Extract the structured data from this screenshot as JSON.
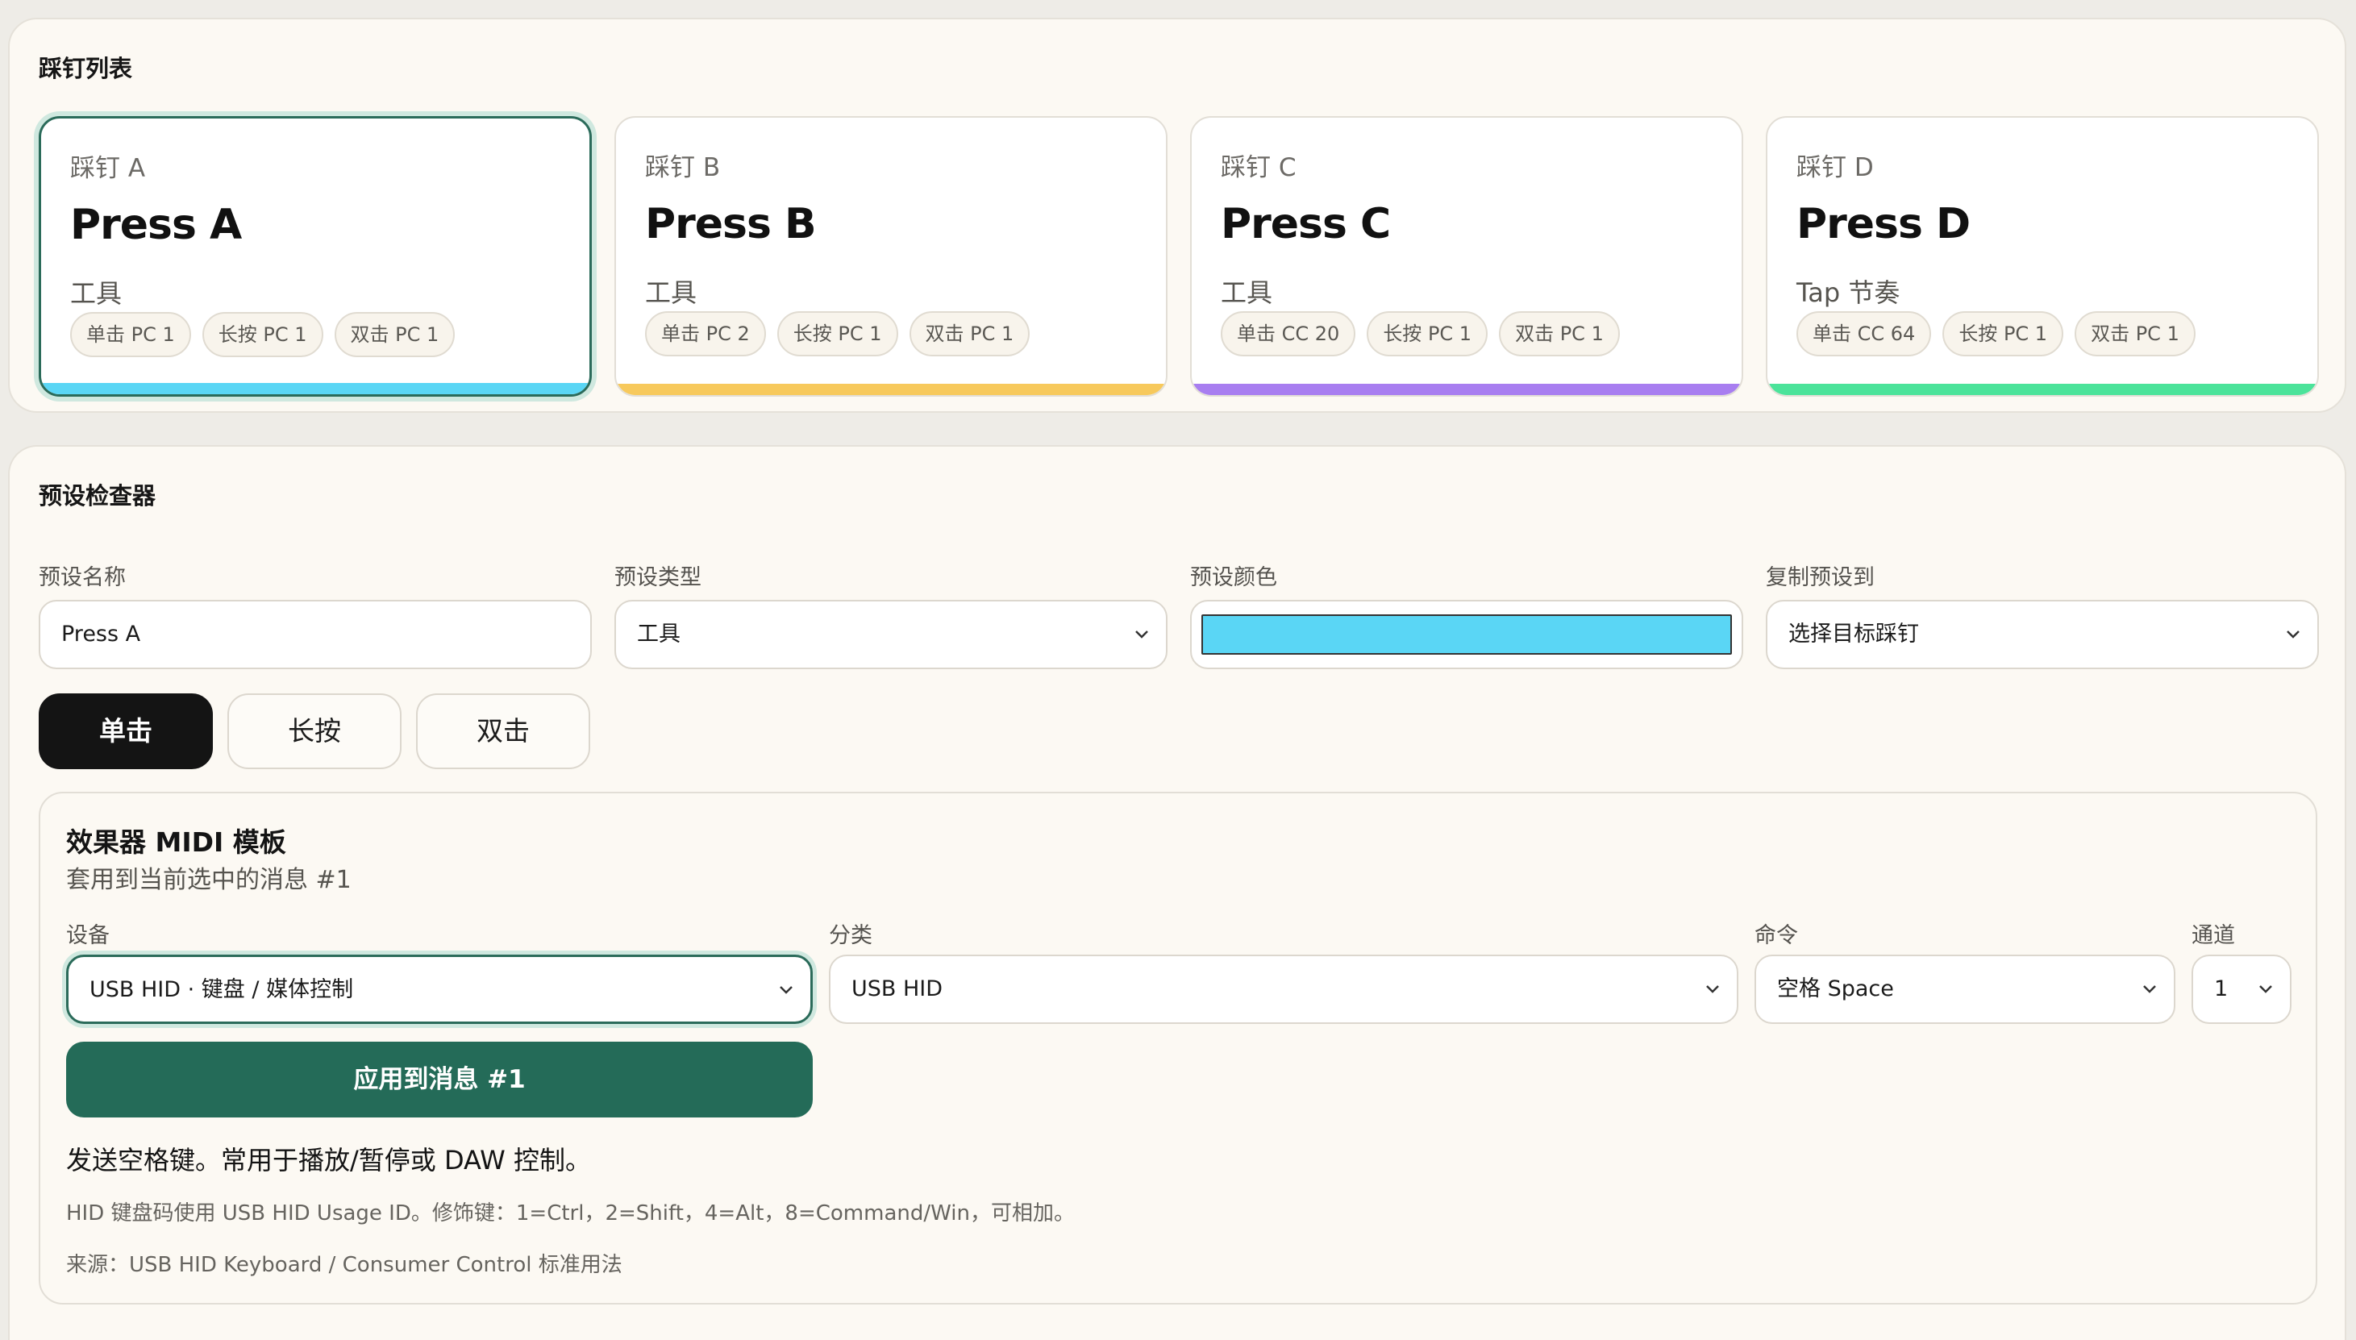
{
  "pedal_list": {
    "title": "踩钉列表",
    "cards": [
      {
        "label": "踩钉 A",
        "name": "Press A",
        "type": "工具",
        "chips": [
          "单击 PC 1",
          "长按 PC 1",
          "双击 PC 1"
        ],
        "color": "#5ad6f5",
        "selected": true
      },
      {
        "label": "踩钉 B",
        "name": "Press B",
        "type": "工具",
        "chips": [
          "单击 PC 2",
          "长按 PC 1",
          "双击 PC 1"
        ],
        "color": "#f7c95c",
        "selected": false
      },
      {
        "label": "踩钉 C",
        "name": "Press C",
        "type": "工具",
        "chips": [
          "单击 CC 20",
          "长按 PC 1",
          "双击 PC 1"
        ],
        "color": "#a87ef0",
        "selected": false
      },
      {
        "label": "踩钉 D",
        "name": "Press D",
        "type": "Tap 节奏",
        "chips": [
          "单击 CC 64",
          "长按 PC 1",
          "双击 PC 1"
        ],
        "color": "#4be39a",
        "selected": false
      }
    ]
  },
  "inspector": {
    "title": "预设检查器",
    "preset_name_label": "预设名称",
    "preset_name_value": "Press A",
    "preset_type_label": "预设类型",
    "preset_type_value": "工具",
    "preset_color_label": "预设颜色",
    "preset_color_value": "#5ad6f5",
    "copy_to_label": "复制预设到",
    "copy_to_value": "选择目标踩钉",
    "modes": [
      {
        "label": "单击",
        "active": true
      },
      {
        "label": "长按",
        "active": false
      },
      {
        "label": "双击",
        "active": false
      }
    ]
  },
  "template": {
    "title": "效果器 MIDI 模板",
    "subtitle": "套用到当前选中的消息 #1",
    "device_label": "设备",
    "device_value": "USB HID · 键盘 / 媒体控制",
    "category_label": "分类",
    "category_value": "USB HID",
    "command_label": "命令",
    "command_value": "空格 Space",
    "channel_label": "通道",
    "channel_value": "1",
    "apply_label": "应用到消息 #1",
    "description": "发送空格键。常用于播放/暂停或 DAW 控制。",
    "note_hid": "HID 键盘码使用 USB HID Usage ID。修饰键：1=Ctrl，2=Shift，4=Alt，8=Command/Win，可相加。",
    "note_source": "来源：USB HID Keyboard / Consumer Control 标准用法"
  },
  "colors": {
    "accent_green": "#246b58",
    "selected_ring": "#cfe8df"
  },
  "icons": [
    "chevron-down-icon"
  ]
}
